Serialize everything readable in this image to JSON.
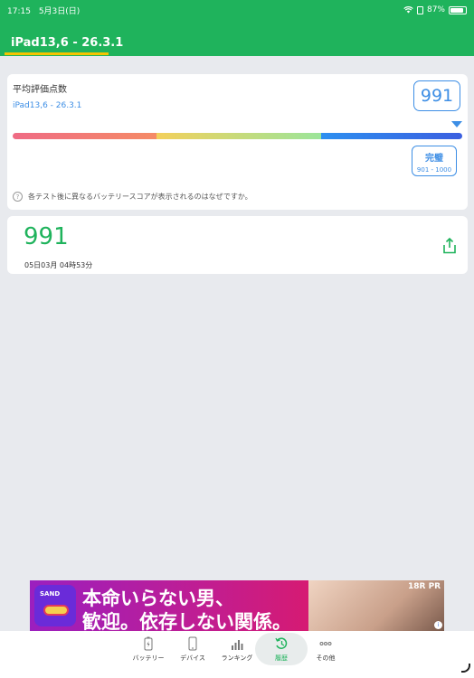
{
  "status_bar": {
    "time": "17:15",
    "date": "5月3日(日)",
    "battery": "87%"
  },
  "header": {
    "tab_label": "iPad13,6 - 26.3.1"
  },
  "score_card": {
    "title": "平均評価点数",
    "device": "iPad13,6 - 26.3.1",
    "score": "991",
    "rating_label": "完璧",
    "rating_range": "901 - 1000",
    "help_text": "各テスト後に異なるバッテリースコアが表示されるのはなぜですか。"
  },
  "result_card": {
    "score": "991",
    "timestamp": "05日03月 04時53分"
  },
  "ad": {
    "logo_text": "SAND",
    "line1": "本命いらない男、",
    "line2": "歓迎。依存しない関係。",
    "badge": "18R PR"
  },
  "tabbar": {
    "items": [
      {
        "label": "バッテリー",
        "icon": "battery-icon"
      },
      {
        "label": "デバイス",
        "icon": "device-icon"
      },
      {
        "label": "ランキング",
        "icon": "ranking-icon"
      },
      {
        "label": "履歴",
        "icon": "history-icon"
      },
      {
        "label": "その他",
        "icon": "more-icon"
      }
    ],
    "active_index": 3
  },
  "colors": {
    "brand_green": "#1fb35c",
    "accent_blue": "#3d8ee5"
  }
}
